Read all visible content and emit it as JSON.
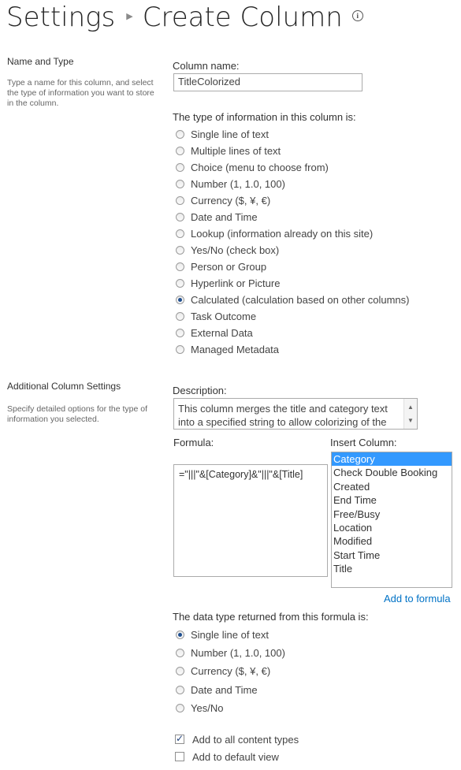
{
  "header": {
    "breadcrumb_root": "Settings",
    "page_title": "Create Column"
  },
  "name_type": {
    "heading": "Name and Type",
    "description": "Type a name for this column, and select the type of information you want to store in the column.",
    "column_name_label": "Column name:",
    "column_name_value": "TitleColorized",
    "type_label": "The type of information in this column is:",
    "types": [
      {
        "label": "Single line of text",
        "checked": false
      },
      {
        "label": "Multiple lines of text",
        "checked": false
      },
      {
        "label": "Choice (menu to choose from)",
        "checked": false
      },
      {
        "label": "Number (1, 1.0, 100)",
        "checked": false
      },
      {
        "label": "Currency ($, ¥, €)",
        "checked": false
      },
      {
        "label": "Date and Time",
        "checked": false
      },
      {
        "label": "Lookup (information already on this site)",
        "checked": false
      },
      {
        "label": "Yes/No (check box)",
        "checked": false
      },
      {
        "label": "Person or Group",
        "checked": false
      },
      {
        "label": "Hyperlink or Picture",
        "checked": false
      },
      {
        "label": "Calculated (calculation based on other columns)",
        "checked": true
      },
      {
        "label": "Task Outcome",
        "checked": false
      },
      {
        "label": "External Data",
        "checked": false
      },
      {
        "label": "Managed Metadata",
        "checked": false
      }
    ]
  },
  "additional": {
    "heading": "Additional Column Settings",
    "description": "Specify detailed options for the type of information you selected.",
    "description_label": "Description:",
    "description_value": "This column merges the title and category text into a specified string to allow colorizing of the",
    "formula_label": "Formula:",
    "formula_value": "=\"|||\"&[Category]&\"|||\"&[Title]",
    "insert_column_label": "Insert Column:",
    "insert_columns": [
      "Category",
      "Check Double Booking",
      "Created",
      "End Time",
      "Free/Busy",
      "Location",
      "Modified",
      "Start Time",
      "Title"
    ],
    "selected_column": "Category",
    "add_to_formula": "Add to formula",
    "return_type_label": "The data type returned from this formula is:",
    "return_types": [
      {
        "label": "Single line of text",
        "checked": true
      },
      {
        "label": "Number (1, 1.0, 100)",
        "checked": false
      },
      {
        "label": "Currency ($, ¥, €)",
        "checked": false
      },
      {
        "label": "Date and Time",
        "checked": false
      },
      {
        "label": "Yes/No",
        "checked": false
      }
    ],
    "checkboxes": [
      {
        "label": "Add to all content types",
        "checked": true
      },
      {
        "label": "Add to default view",
        "checked": false
      }
    ]
  },
  "icons": {
    "breadcrumb_separator": "triangle-right",
    "info": "info-circle"
  }
}
